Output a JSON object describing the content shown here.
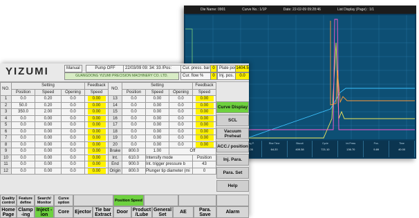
{
  "curve_screen": {
    "title_fields": [
      "Die Name: 0901",
      "Curve No.: 1/1P",
      "Date: 22-02-09 09:28:46",
      "List Display (Page) : 1/1"
    ],
    "stats": [
      {
        "label": "Inj.Speed",
        "value": "0.64"
      },
      {
        "label": "Inj.Press",
        "value": "27.70"
      },
      {
        "label": "Casting P.",
        "value": "231.05"
      },
      {
        "label": "Rise Time",
        "value": "64.20"
      },
      {
        "label": "Biscuit",
        "value": "409.38"
      },
      {
        "label": "Cycle",
        "value": "721.10"
      },
      {
        "label": "Int.Press",
        "value": "136.70"
      },
      {
        "label": "Pos.",
        "value": "9.89"
      },
      {
        "label": "Time",
        "value": "40.00"
      }
    ]
  },
  "panel": {
    "logo": "YIZUMI",
    "mode": "Manual",
    "pump": "Pump OFF",
    "datetime": "22/03/09 09: 34: 33 /Pos:",
    "company": "GUANGDONG YIZUMI PRECISION MACHINERY CO. LTD.",
    "cur_press_label": "Cur. press. bar",
    "cur_press_val": "0",
    "plate_pos_label": "Plate pos.mm",
    "plate_pos_val": "1404.5",
    "cur_flow_label": "Cur. flow  %",
    "cur_flow_val": "0",
    "inj_pos_label": "Inj. pos. mm",
    "inj_pos_val": "0.0"
  },
  "table": {
    "headers": {
      "no": "NO.",
      "setting": "Setting",
      "feedback": "Feedback",
      "position": "Position",
      "speed": "Speed",
      "opening": "Opening",
      "speed2": "Speed"
    },
    "left_rows": [
      [
        "1",
        "0.0",
        "0.20",
        "0.0",
        "0.00"
      ],
      [
        "2",
        "50.0",
        "0.20",
        "0.0",
        "0.00"
      ],
      [
        "3",
        "350.0",
        "2.00",
        "0.0",
        "0.00"
      ],
      [
        "4",
        "0.0",
        "0.00",
        "0.0",
        "0.00"
      ],
      [
        "5",
        "0.0",
        "0.00",
        "0.0",
        "0.00"
      ],
      [
        "6",
        "0.0",
        "0.00",
        "0.0",
        "0.00"
      ],
      [
        "7",
        "0.0",
        "0.00",
        "0.0",
        "0.00"
      ],
      [
        "8",
        "0.0",
        "0.00",
        "0.0",
        "0.00"
      ],
      [
        "9",
        "0.0",
        "0.00",
        "0.0",
        "0.00"
      ],
      [
        "10",
        "0.0",
        "0.00",
        "0.0",
        "0.00"
      ],
      [
        "11",
        "0.0",
        "0.00",
        "0.0",
        "0.00"
      ],
      [
        "12",
        "0.0",
        "0.00",
        "0.0",
        "0.00"
      ]
    ],
    "right_rows": [
      [
        "13",
        "0.0",
        "0.00",
        "0.0",
        "0.00"
      ],
      [
        "14",
        "0.0",
        "0.00",
        "0.0",
        "0.00"
      ],
      [
        "15",
        "0.0",
        "0.00",
        "0.0",
        "0.00"
      ],
      [
        "16",
        "0.0",
        "0.00",
        "0.0",
        "0.00"
      ],
      [
        "17",
        "0.0",
        "0.00",
        "0.0",
        "0.00"
      ],
      [
        "18",
        "0.0",
        "0.00",
        "0.0",
        "0.00"
      ],
      [
        "19",
        "0.0",
        "0.00",
        "0.0",
        "0.00"
      ],
      [
        "20",
        "0.0",
        "0.00",
        "0.0",
        "0.00"
      ]
    ],
    "brake": {
      "label": "Brake",
      "pos": "800.0",
      "speed": "1.00",
      "state": "Off"
    },
    "int": {
      "label": "Int.",
      "pos": "610.0",
      "text": "Intensify mode",
      "mode": "Position"
    },
    "end": {
      "label": "End",
      "pos": "900.0",
      "text": "Int. trigger pressure  b",
      "val": "43"
    },
    "orign": {
      "label": "Origin",
      "pos": "800.0",
      "text": "Plunger tip diameter (mi",
      "val": "0"
    }
  },
  "side_buttons": [
    "Curve Display",
    "SCL",
    "Vacuum Preheat",
    "ACC./ position",
    "Inj. Para.",
    "Para. Set",
    "Help"
  ],
  "mode_buttons": [
    "Quality control",
    "Feature define",
    "Search/ Monitor",
    "Curve option",
    "",
    "Position Speed",
    "",
    "",
    ""
  ],
  "nav_buttons": [
    "Home Page",
    "Clamp -ing",
    "Inject -ion",
    "Core",
    "Ejector",
    "Tie bar Extract",
    "Door",
    "Product /Lube",
    "General Set",
    "AE",
    "Para. Save",
    "Alarm"
  ],
  "colors": {
    "accent": "#6ed13f",
    "feedback": "#fff200",
    "plot_bg": "#0d4f74"
  }
}
